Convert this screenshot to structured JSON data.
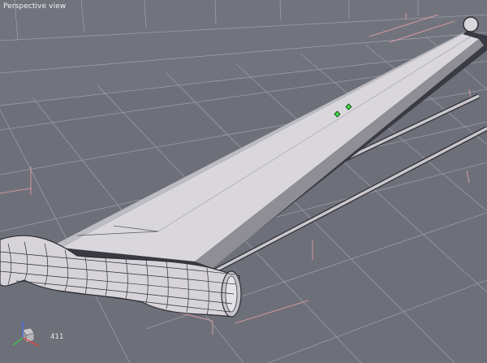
{
  "viewport": {
    "label": "Perspective view",
    "background": "#6e7079",
    "grid_color": "#9a9ca6",
    "wire_color": "#2f2f35",
    "surface_color": "#d9d7dc",
    "guide_color": "#e8a0a8",
    "point_color": "#3fd24a"
  },
  "status": {
    "count": "411"
  },
  "gizmo": {
    "axes": [
      "x-axis",
      "y-axis",
      "z-axis"
    ],
    "x_color": "#e04848",
    "y_color": "#3cc850",
    "z_color": "#4a6cf0"
  },
  "icons": [
    "axis-gizmo-icon",
    "control-point-icon"
  ]
}
